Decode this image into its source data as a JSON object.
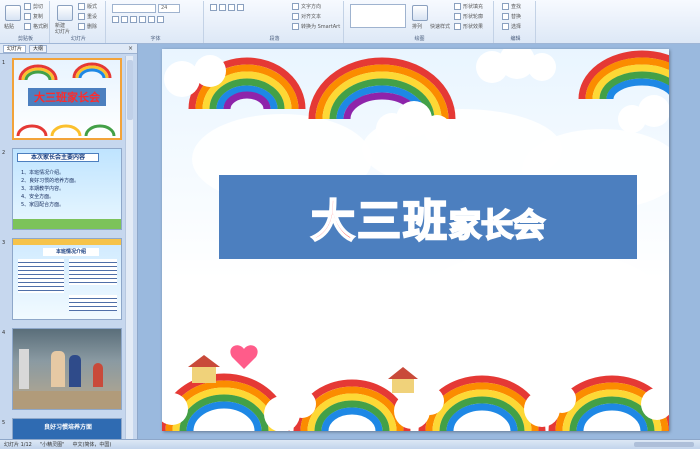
{
  "ribbon": {
    "clipboard": {
      "paste": "粘贴",
      "cut": "剪切",
      "copy": "复制",
      "format_painter": "格式刷",
      "label": "剪贴板"
    },
    "slides": {
      "new_slide": "新建\n幻灯片",
      "layout": "版式",
      "reset": "重设",
      "delete": "删除",
      "label": "幻灯片"
    },
    "font": {
      "size": "24",
      "label": "字体"
    },
    "paragraph": {
      "text_direction": "文字方向",
      "align_text": "对齐文本",
      "smartart": "转换为 SmartArt",
      "label": "段落"
    },
    "drawing": {
      "arrange": "排列",
      "quick_styles": "快速样式",
      "shape_fill": "形状填充",
      "shape_outline": "形状轮廓",
      "shape_effects": "形状效果",
      "label": "绘图"
    },
    "editing": {
      "find": "查找",
      "replace": "替换",
      "select": "选择",
      "label": "编辑"
    }
  },
  "panel": {
    "tabs": [
      "幻灯片",
      "大纲"
    ],
    "close": "×"
  },
  "thumbs": [
    {
      "num": "1",
      "title": "大三班家长会"
    },
    {
      "num": "2",
      "title": "本次家长会主要内容",
      "items": [
        "1、本班情况介绍。",
        "2、良好习惯的培养方面。",
        "3、本期教学内容。",
        "4、安全方面。",
        "5、家园配合方面。"
      ]
    },
    {
      "num": "3",
      "title": "本班情况介绍"
    },
    {
      "num": "4"
    },
    {
      "num": "5",
      "title": "良好习惯培养方面"
    }
  ],
  "slide": {
    "title_big": "大三班",
    "title_small": "家长会"
  },
  "status": {
    "slide_info": "幻灯片 1/12",
    "theme": "\"小精灵图\"",
    "language": "中文(简体，中国)"
  },
  "colors": {
    "title_box": "#4c7fbf",
    "title_text": "#ff2a2a",
    "selected_border": "#f2a33a"
  }
}
